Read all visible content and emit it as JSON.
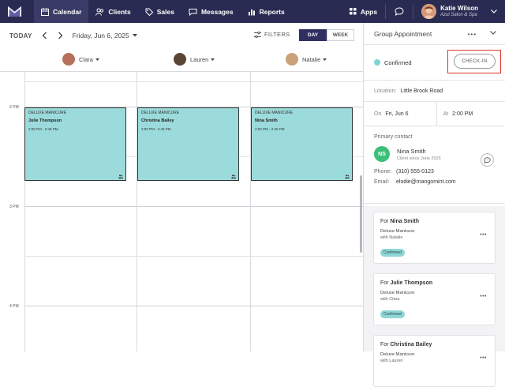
{
  "nav": {
    "items": [
      {
        "label": "Calendar",
        "icon": "calendar-icon"
      },
      {
        "label": "Clients",
        "icon": "clients-icon"
      },
      {
        "label": "Sales",
        "icon": "sales-tag-icon"
      },
      {
        "label": "Messages",
        "icon": "messages-icon"
      },
      {
        "label": "Reports",
        "icon": "reports-icon"
      }
    ],
    "apps_label": "Apps",
    "user_name": "Katie Wilson",
    "user_business": "Azul Salon & Spa"
  },
  "toolbar": {
    "today_label": "TODAY",
    "date_label": "Friday, Jun 6, 2025",
    "filters_label": "FILTERS",
    "view_day": "DAY",
    "view_week": "WEEK"
  },
  "staff": [
    {
      "name": "Clara",
      "color": "#b4705a"
    },
    {
      "name": "Lauren",
      "color": "#5a4535"
    },
    {
      "name": "Natalie",
      "color": "#c9a27a"
    }
  ],
  "times": [
    "2 PM",
    "3 PM",
    "4 PM"
  ],
  "appointments": [
    {
      "service": "DELUXE MANICURE",
      "client": "Julie Thompson",
      "time": "2:00 PM - 2:45 PM"
    },
    {
      "service": "DELUXE MANICURE",
      "client": "Christina Bailey",
      "time": "2:00 PM - 2:45 PM"
    },
    {
      "service": "DELUXE MANICURE",
      "client": "Nina Smith",
      "time": "2:00 PM - 2:45 PM"
    }
  ],
  "panel": {
    "title": "Group Appointment",
    "status": "Confirmed",
    "checkin_label": "CHECK-IN",
    "location_label": "Location:",
    "location_value": "Little Brook Road",
    "on_label": "On",
    "on_value": "Fri, Jun 6",
    "at_label": "At",
    "at_value": "2:00 PM",
    "contact_heading": "Primary contact",
    "contact_initials": "NS",
    "contact_name": "Nina Smith",
    "contact_since": "Client since June 2025",
    "phone_label": "Phone:",
    "phone_value": "(310) 555-0123",
    "email_label": "Email:",
    "email_value": "elodie@mangomint.com"
  },
  "cards": [
    {
      "for_label": "For",
      "name": "Nina Smith",
      "service": "Deluxe Manicure",
      "with": "with Natalie",
      "status": "Confirmed"
    },
    {
      "for_label": "For",
      "name": "Julie Thompson",
      "service": "Deluxe Manicure",
      "with": "with Clara",
      "status": "Confirmed"
    },
    {
      "for_label": "For",
      "name": "Christina Bailey",
      "service": "Deluxe Manicure",
      "with": "with Lauren",
      "status": ""
    }
  ],
  "colors": {
    "nav_bg": "#2a2b52",
    "appointment_fill": "#9bdbdc",
    "confirmed_dot": "#7fd3d4",
    "highlight": "#e0352b",
    "contact_avatar": "#3cbf7a"
  }
}
